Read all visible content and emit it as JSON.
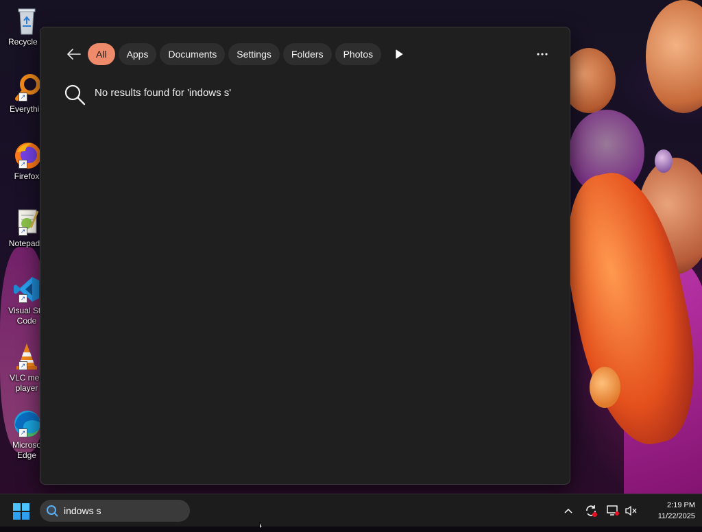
{
  "desktop": {
    "icons": [
      {
        "label": "Recycle B",
        "icon": "recycle-bin-icon"
      },
      {
        "label": "Everythin",
        "icon": "everything-search-icon"
      },
      {
        "label": "Firefox",
        "icon": "firefox-icon"
      },
      {
        "label": "Notepad+",
        "icon": "notepad-plus-plus-icon"
      },
      {
        "label": "Visual Stu\nCode",
        "label_line1": "Visual Stu",
        "label_line2": "Code",
        "icon": "vscode-icon"
      },
      {
        "label_line1": "VLC med",
        "label_line2": "player",
        "icon": "vlc-icon"
      },
      {
        "label_line1": "Microso",
        "label_line2": "Edge",
        "icon": "edge-icon"
      }
    ]
  },
  "search_panel": {
    "filters": [
      {
        "label": "All",
        "active": true
      },
      {
        "label": "Apps",
        "active": false
      },
      {
        "label": "Documents",
        "active": false
      },
      {
        "label": "Settings",
        "active": false
      },
      {
        "label": "Folders",
        "active": false
      },
      {
        "label": "Photos",
        "active": false
      }
    ],
    "no_results_text": "No results found for 'indows s'"
  },
  "taskbar": {
    "search_value": "indows s",
    "clock_time": "2:19 PM",
    "clock_date": "11/22/2025"
  },
  "colors": {
    "accent_chip": "#ef8a6b",
    "panel_bg": "#1f1f1f",
    "taskbar_bg": "#1c1c1c"
  }
}
